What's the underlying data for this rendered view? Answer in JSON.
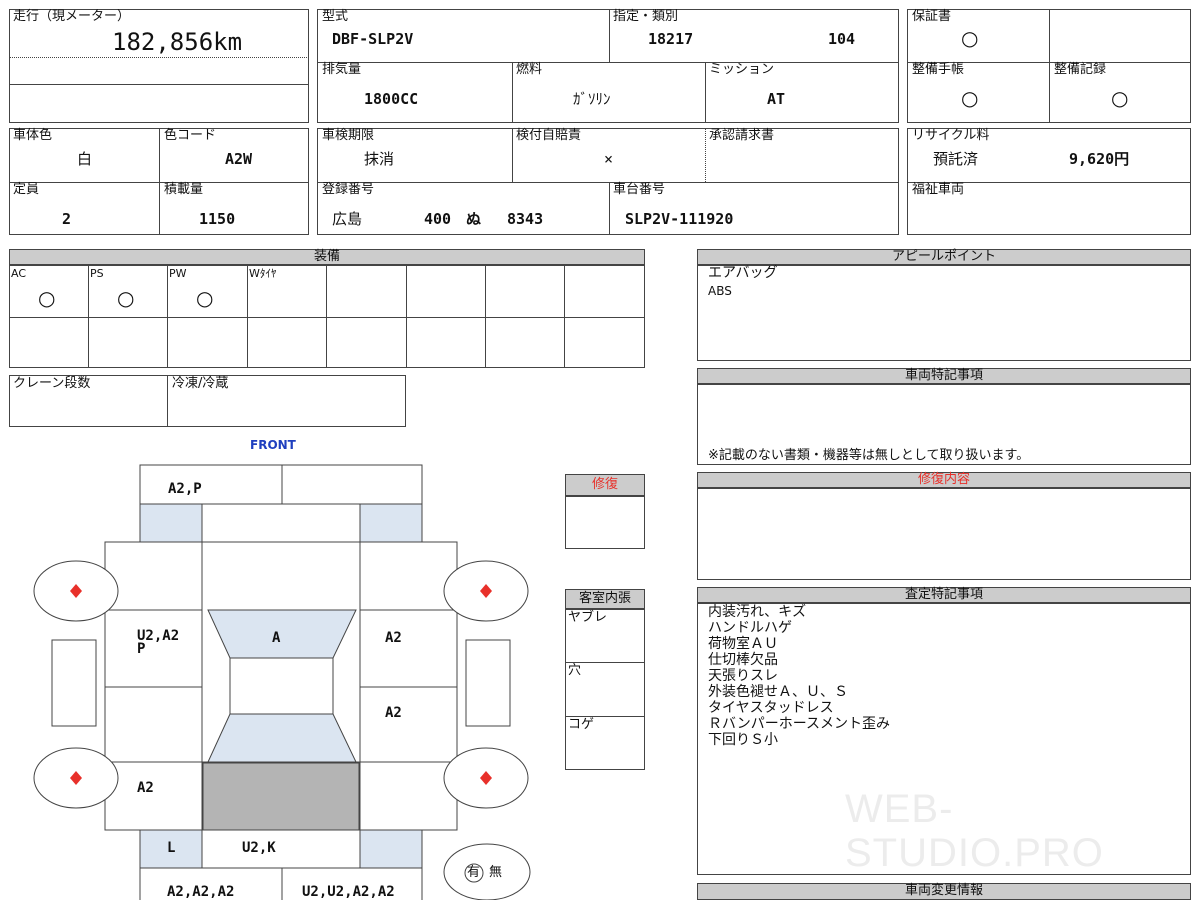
{
  "mileage": {
    "label": "走行（現メーター）",
    "value": "182,856km"
  },
  "model": {
    "label": "型式",
    "value": "DBF-SLP2V"
  },
  "designation": {
    "label": "指定・類別",
    "value1": "18217",
    "value2": "104"
  },
  "warranty": {
    "label": "保証書",
    "mark": "○"
  },
  "displacement": {
    "label": "排気量",
    "value": "1800CC"
  },
  "fuel": {
    "label": "燃料",
    "value": "ｶﾞｿﾘﾝ"
  },
  "mission": {
    "label": "ミッション",
    "value": "AT"
  },
  "service_book": {
    "label": "整備手帳",
    "mark": "○"
  },
  "service_record": {
    "label": "整備記録",
    "mark": "○"
  },
  "body_color": {
    "label": "車体色",
    "value": "白"
  },
  "color_code": {
    "label": "色コード",
    "value": "A2W"
  },
  "inspection": {
    "label": "車検期限",
    "value": "抹消"
  },
  "insurance": {
    "label": "検付自賠責",
    "value": "×"
  },
  "approval": {
    "label": "承認請求書"
  },
  "recycle": {
    "label": "リサイクル料",
    "status": "預託済",
    "amount": "9,620円"
  },
  "capacity": {
    "label": "定員",
    "value": "2"
  },
  "load": {
    "label": "積載量",
    "value": "1150"
  },
  "registration": {
    "label": "登録番号",
    "area": "広島",
    "class": "400",
    "kana": "ぬ",
    "number": "8343"
  },
  "chassis": {
    "label": "車台番号",
    "value": "SLP2V-111920"
  },
  "welfare": {
    "label": "福祉車両"
  },
  "equipment": {
    "title": "装備",
    "items": [
      {
        "label": "AC",
        "mark": "○"
      },
      {
        "label": "PS",
        "mark": "○"
      },
      {
        "label": "PW",
        "mark": "○"
      },
      {
        "label": "Wﾀｲﾔ",
        "mark": ""
      }
    ]
  },
  "crane": {
    "label": "クレーン段数"
  },
  "freezer": {
    "label": "冷凍/冷蔵"
  },
  "appeal": {
    "title": "アピールポイント",
    "text": "エアバッグ",
    "text2": "ABS"
  },
  "special_notes": {
    "title": "車両特記事項",
    "footer": "※記載のない書類・機器等は無しとして取り扱います。"
  },
  "repair_detail": {
    "title": "修復内容"
  },
  "assessment": {
    "title": "査定特記事項",
    "lines": [
      "内装汚れ、キズ",
      "ハンドルハゲ",
      "荷物室ＡＵ",
      "仕切棒欠品",
      "天張りスレ",
      "外装色褪せＡ、Ｕ、Ｓ",
      "タイヤスタッドレス",
      "Ｒバンパーホースメント歪み",
      "下回りＳ小"
    ]
  },
  "vehicle_change": {
    "title": "車両変更情報"
  },
  "repair": {
    "label": "修復"
  },
  "interior": {
    "title": "客室内張",
    "items": [
      "ヤブレ",
      "穴",
      "コゲ"
    ]
  },
  "diagram": {
    "front": "FRONT",
    "front_bumper": "A2,P",
    "left_front": "U2,A2\nP",
    "hood": "A",
    "right_front": "A2",
    "right_rear": "A2",
    "left_rear": "A2",
    "rear_left": "L",
    "rear_center": "U2,K",
    "rear_bumper_left": "A2,A2,A2",
    "rear_bumper_right": "U2,U2,A2,A2"
  },
  "presence": {
    "yes": "有",
    "no": "無"
  },
  "watermark": "WEB-STUDIO.PRO",
  "colors": {
    "header_gray": "#cccccc",
    "panel_blue": "#dbe5f1",
    "accent_red": "#e8302a",
    "front_blue": "#1f3fbf",
    "dark_gray": "#b4b4b4"
  }
}
